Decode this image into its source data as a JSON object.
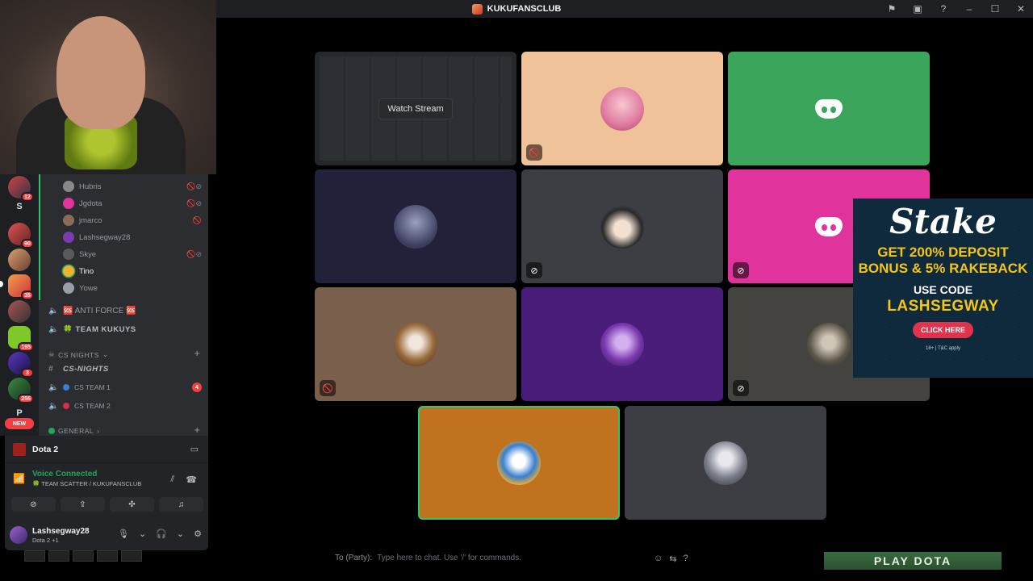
{
  "titlebar": {
    "server_name": "KUKUFANSCLUB"
  },
  "tiles": {
    "stream": {
      "watch_label": "Watch Stream"
    }
  },
  "chat": {
    "label": "To (Party):",
    "placeholder": "Type here to chat. Use '/' for commands."
  },
  "play_button": "PLAY DOTA",
  "ad": {
    "brand": "Stake",
    "headline": "GET 200% DEPOSIT BONUS & 5% RAKEBACK",
    "use_code": "USE CODE",
    "code": "LASHSEGWAY",
    "cta": "CLICK HERE",
    "terms": "18+ | T&C apply"
  },
  "rail": {
    "badges": [
      "12",
      "90",
      "35",
      "195",
      "3",
      "256"
    ],
    "letters": [
      "S",
      "P"
    ],
    "new_label": "NEW"
  },
  "members": [
    {
      "name": "Hubris"
    },
    {
      "name": "Jgdota"
    },
    {
      "name": "jmarco"
    },
    {
      "name": "Lashsegway28"
    },
    {
      "name": "Skye"
    },
    {
      "name": "Tino"
    },
    {
      "name": "Yowe"
    }
  ],
  "channels": {
    "anti_force": "🆘 ANTI FORCE 🆘",
    "team_kukuys": "🍀 TEAM KUKUYS",
    "cs_nights_category": "CS NIGHTS",
    "cs_nights_text": "CS-NIGHTS",
    "cs_team_1": "CS TEAM 1",
    "cs_team_2": "CS TEAM 2",
    "cs_team_1_badge": "4",
    "general_category": "GENERAL"
  },
  "panel": {
    "activity": "Dota 2",
    "voice_status": "Voice Connected",
    "voice_channel": "🍀 TEAM SCATTER / KUKUFANSCLUB",
    "username": "Lashsegway28",
    "user_status": "Dota 2 +1"
  }
}
